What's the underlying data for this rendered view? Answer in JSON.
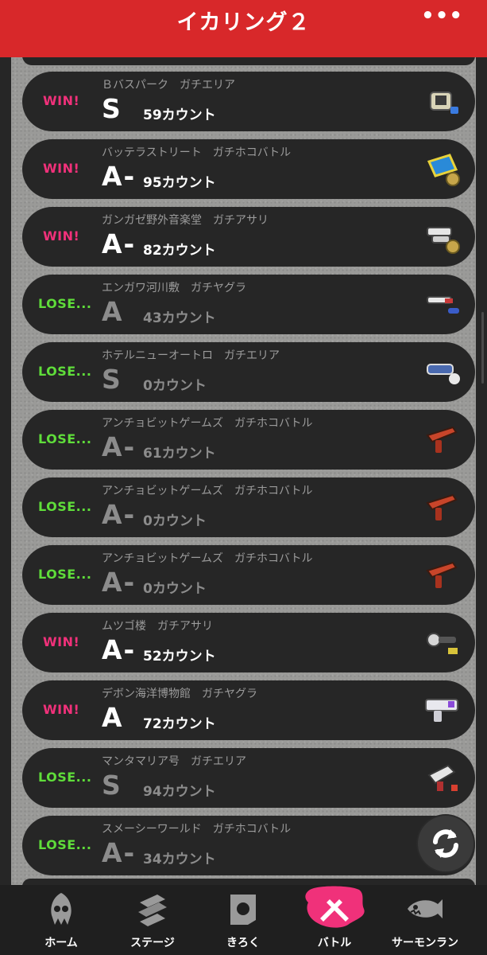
{
  "header": {
    "title": "イカリング２",
    "more_icon": "ellipsis-icon"
  },
  "battles": [
    {
      "result": "WIN!",
      "stage": "Ｂバスパーク",
      "mode": "ガチエリア",
      "rank": "S",
      "count": "59カウント",
      "outcome": "win"
    },
    {
      "result": "WIN!",
      "stage": "バッテラストリート",
      "mode": "ガチホコバトル",
      "rank": "A-",
      "count": "95カウント",
      "outcome": "win"
    },
    {
      "result": "WIN!",
      "stage": "ガンガゼ野外音楽堂",
      "mode": "ガチアサリ",
      "rank": "A-",
      "count": "82カウント",
      "outcome": "win"
    },
    {
      "result": "LOSE...",
      "stage": "エンガワ河川敷",
      "mode": "ガチヤグラ",
      "rank": "A",
      "count": "43カウント",
      "outcome": "lose"
    },
    {
      "result": "LOSE...",
      "stage": "ホテルニューオートロ",
      "mode": "ガチエリア",
      "rank": "S",
      "count": "0カウント",
      "outcome": "lose"
    },
    {
      "result": "LOSE...",
      "stage": "アンチョビットゲームズ",
      "mode": "ガチホコバトル",
      "rank": "A-",
      "count": "61カウント",
      "outcome": "lose"
    },
    {
      "result": "LOSE...",
      "stage": "アンチョビットゲームズ",
      "mode": "ガチホコバトル",
      "rank": "A-",
      "count": "0カウント",
      "outcome": "lose"
    },
    {
      "result": "LOSE...",
      "stage": "アンチョビットゲームズ",
      "mode": "ガチホコバトル",
      "rank": "A-",
      "count": "0カウント",
      "outcome": "lose"
    },
    {
      "result": "WIN!",
      "stage": "ムツゴ楼",
      "mode": "ガチアサリ",
      "rank": "A-",
      "count": "52カウント",
      "outcome": "win"
    },
    {
      "result": "WIN!",
      "stage": "デボン海洋博物館",
      "mode": "ガチヤグラ",
      "rank": "A",
      "count": "72カウント",
      "outcome": "win"
    },
    {
      "result": "LOSE...",
      "stage": "マンタマリア号",
      "mode": "ガチエリア",
      "rank": "S",
      "count": "94カウント",
      "outcome": "lose"
    },
    {
      "result": "LOSE...",
      "stage": "スメーシーワールド",
      "mode": "ガチホコバトル",
      "rank": "A-",
      "count": "34カウント",
      "outcome": "lose"
    }
  ],
  "nav": {
    "items": [
      {
        "label": "ホーム",
        "icon": "squid-icon",
        "active": false
      },
      {
        "label": "ステージ",
        "icon": "stage-icon",
        "active": false
      },
      {
        "label": "きろく",
        "icon": "record-icon",
        "active": false
      },
      {
        "label": "バトル",
        "icon": "battle-icon",
        "active": true
      },
      {
        "label": "サーモンラン",
        "icon": "salmon-icon",
        "active": false
      }
    ]
  },
  "colors": {
    "header": "#d8282a",
    "win": "#f0317a",
    "lose": "#5fdd3a",
    "active_tab": "#f0317a"
  }
}
